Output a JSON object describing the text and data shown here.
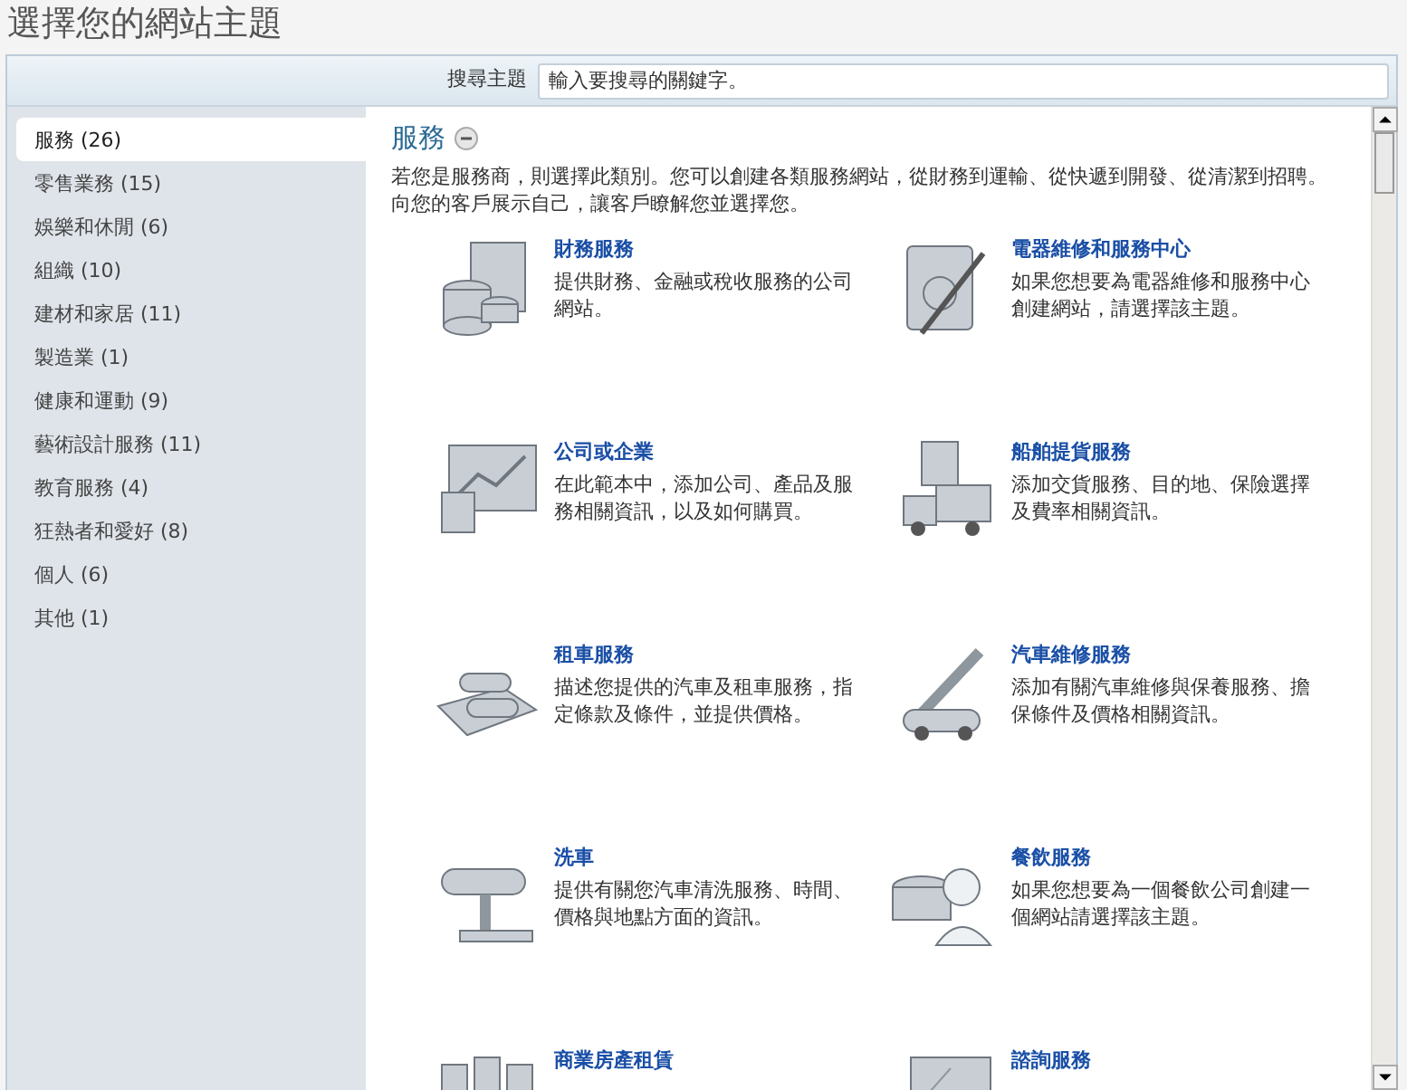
{
  "window": {
    "title": "選擇您的網站主題"
  },
  "search": {
    "label": "搜尋主題",
    "placeholder": "輸入要搜尋的關鍵字。"
  },
  "sidebar": {
    "items": [
      {
        "label": "服務 (26)",
        "selected": true
      },
      {
        "label": "零售業務 (15)",
        "selected": false
      },
      {
        "label": "娛樂和休閒 (6)",
        "selected": false
      },
      {
        "label": "組織 (10)",
        "selected": false
      },
      {
        "label": "建材和家居 (11)",
        "selected": false
      },
      {
        "label": "製造業 (1)",
        "selected": false
      },
      {
        "label": "健康和運動 (9)",
        "selected": false
      },
      {
        "label": "藝術設計服務 (11)",
        "selected": false
      },
      {
        "label": "教育服務 (4)",
        "selected": false
      },
      {
        "label": "狂熱者和愛好 (8)",
        "selected": false
      },
      {
        "label": "個人 (6)",
        "selected": false
      },
      {
        "label": "其他 (1)",
        "selected": false
      }
    ]
  },
  "category": {
    "title": "服務",
    "expanded": true,
    "description": "若您是服務商，則選擇此類別。您可以創建各類服務網站，從財務到運輸、從快遞到開發、從清潔到招聘。向您的客戶展示自己，讓客戶瞭解您並選擇您。"
  },
  "themes": [
    {
      "title": "財務服務",
      "description": "提供財務、金融或稅收服務的公司網站。"
    },
    {
      "title": "電器維修和服務中心",
      "description": "如果您想要為電器維修和服務中心創建網站，請選擇該主題。"
    },
    {
      "title": "公司或企業",
      "description": "在此範本中，添加公司、產品及服務相關資訊，以及如何購買。"
    },
    {
      "title": "船舶提貨服務",
      "description": "添加交貨服務、目的地、保險選擇及費率相關資訊。"
    },
    {
      "title": "租車服務",
      "description": "描述您提供的汽車及租車服務，指定條款及條件，並提供價格。"
    },
    {
      "title": "汽車維修服務",
      "description": "添加有關汽車維修與保養服務、擔保條件及價格相關資訊。"
    },
    {
      "title": "洗車",
      "description": "提供有關您汽車清洗服務、時間、價格與地點方面的資訊。"
    },
    {
      "title": "餐飲服務",
      "description": "如果您想要為一個餐飲公司創建一個網站請選擇該主題。"
    },
    {
      "title": "商業房產租賃"
    },
    {
      "title": "諮詢服務"
    }
  ]
}
